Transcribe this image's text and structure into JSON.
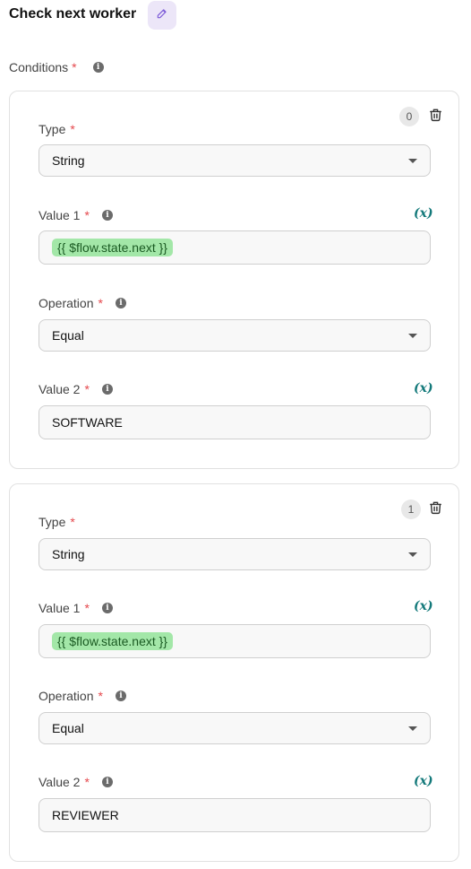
{
  "title": "Check next worker",
  "conditions_label": "Conditions",
  "required_mark": "*",
  "var_button_label": "(x)",
  "conditions": [
    {
      "index": "0",
      "type_label": "Type",
      "type_value": "String",
      "value1_label": "Value 1",
      "value1_chip": "{{ $flow.state.next }}",
      "operation_label": "Operation",
      "operation_value": "Equal",
      "value2_label": "Value 2",
      "value2_value": "SOFTWARE"
    },
    {
      "index": "1",
      "type_label": "Type",
      "type_value": "String",
      "value1_label": "Value 1",
      "value1_chip": "{{ $flow.state.next }}",
      "operation_label": "Operation",
      "operation_value": "Equal",
      "value2_label": "Value 2",
      "value2_value": "REVIEWER"
    }
  ]
}
